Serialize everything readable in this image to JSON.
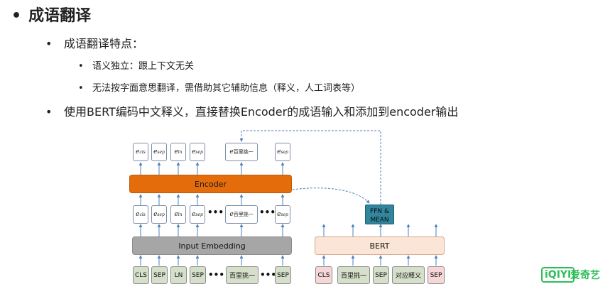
{
  "slide": {
    "bullet_symbol": "•",
    "title": "成语翻译",
    "sub_heading": "成语翻译特点：",
    "points": [
      "语义独立：跟上下文无关",
      "无法按字面意思翻译，需借助其它辅助信息（释义，人工词表等）"
    ],
    "method": "使用BERT编码中文释义，直接替换Encoder的成语输入和添加到encoder输出"
  },
  "diagram": {
    "output_embeddings": [
      {
        "base": "e",
        "sub": "cls"
      },
      {
        "base": "e",
        "sub": "sep"
      },
      {
        "base": "e",
        "sub": "ln"
      },
      {
        "base": "e",
        "sub": "sep"
      },
      {
        "base": "e",
        "sub": "百里挑一"
      },
      {
        "base": "e",
        "sub": "sep"
      }
    ],
    "input_embeddings": [
      {
        "base": "e",
        "sub": "cls"
      },
      {
        "base": "e",
        "sub": "sep"
      },
      {
        "base": "e",
        "sub": "ln"
      },
      {
        "base": "e",
        "sub": "sep"
      },
      {
        "base": "e",
        "sub": "百里挑一"
      },
      {
        "base": "e",
        "sub": "sep"
      }
    ],
    "encoder_label": "Encoder",
    "input_embedding_label": "Input Embedding",
    "ffn_line1": "FFN &",
    "ffn_line2": "MEAN",
    "bert_label": "BERT",
    "input_tokens": [
      "CLS",
      "SEP",
      "LN",
      "SEP",
      "百里挑一",
      "SEP"
    ],
    "bert_tokens": [
      "CLS",
      "百里挑一",
      "SEP",
      "对应释义",
      "SEP"
    ],
    "ellipsis": "•••"
  },
  "logo": {
    "mark": "iQIYI",
    "name": "爱奇艺",
    "color": "#2ebd59"
  }
}
